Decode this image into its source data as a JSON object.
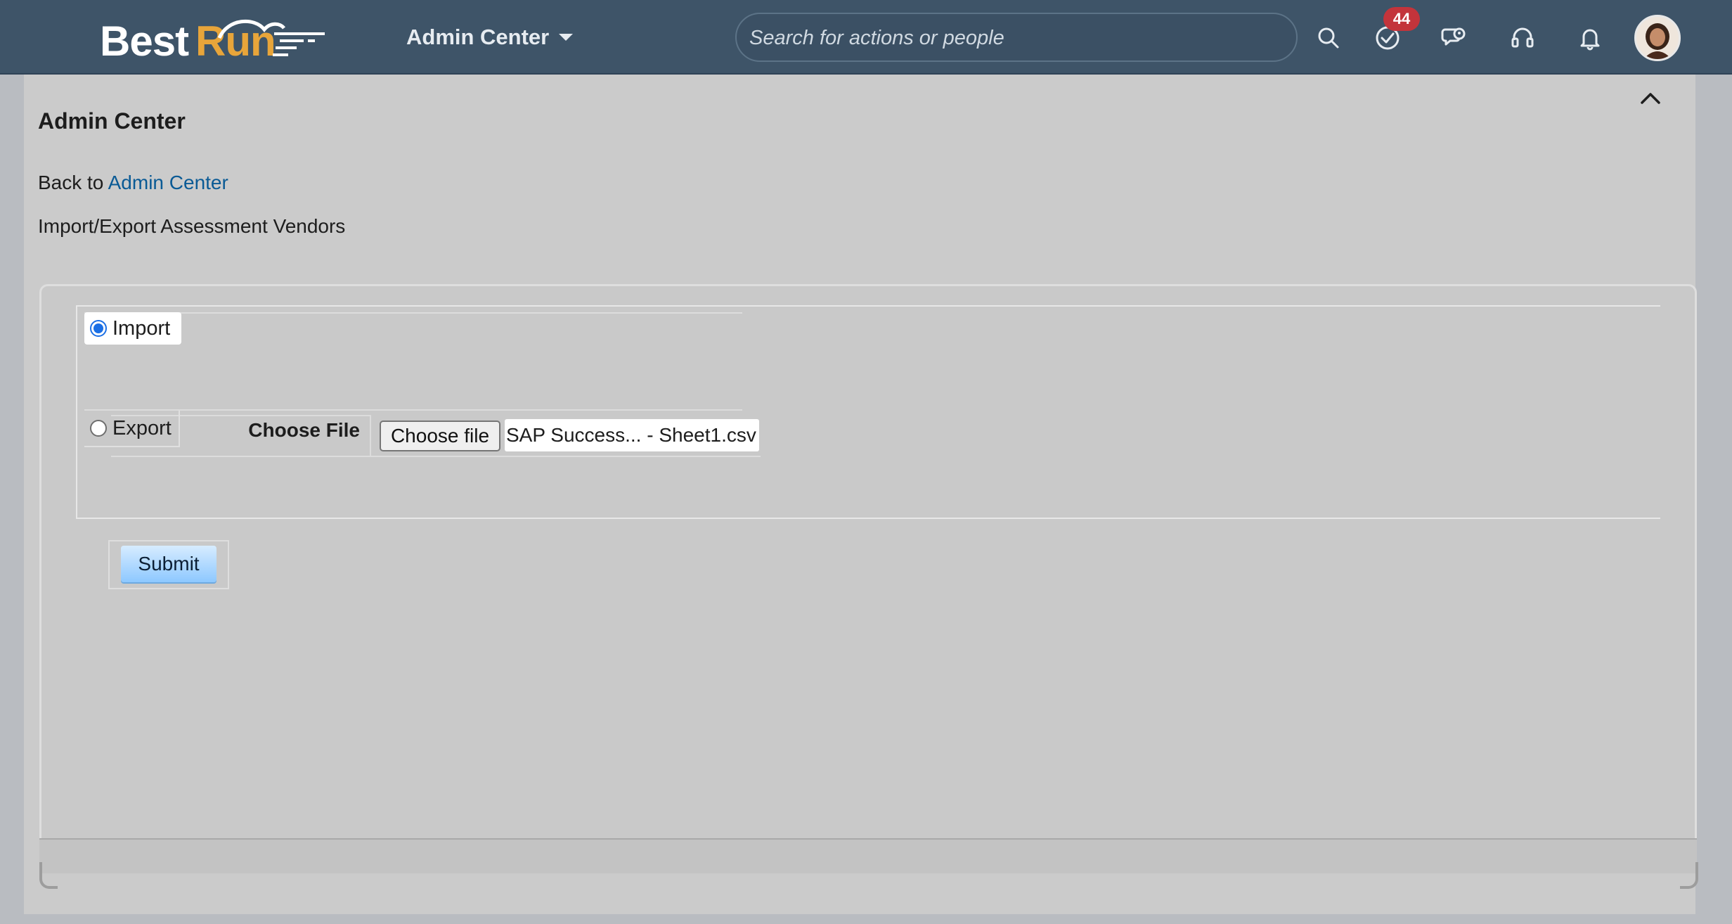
{
  "header": {
    "logo": {
      "part1": "Best",
      "part2": "Run"
    },
    "menu_label": "Admin Center",
    "search_placeholder": "Search for actions or people",
    "todo_badge": "44",
    "icons": [
      "search-icon",
      "todo-check-icon",
      "chat-icon",
      "headset-icon",
      "bell-icon"
    ],
    "brand_colors": {
      "bar": "#3e5468",
      "badge": "#c3343b",
      "logo_accent": "#e8a53a"
    }
  },
  "page": {
    "title": "Admin Center",
    "back_prefix": "Back to",
    "back_link": "Admin Center",
    "subtitle": "Import/Export Assessment Vendors"
  },
  "form": {
    "import_label": "Import",
    "import_selected": true,
    "choose_file_label": "Choose File",
    "choose_file_button": "Choose file",
    "file_name": "SAP Success... - Sheet1.csv",
    "export_label": "Export",
    "export_selected": false,
    "submit_label": "Submit"
  }
}
